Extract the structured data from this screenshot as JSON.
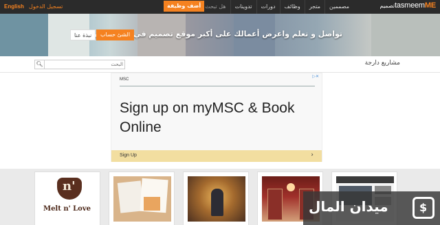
{
  "colors": {
    "accent": "#f58220",
    "topbar": "#2b2b2b",
    "ad_cta": "#f2dea0"
  },
  "topbar": {
    "logo_prefix": "tasmeem",
    "logo_bold": "ME",
    "logo_arabic": "تصميم",
    "nav": [
      "مصممين",
      "متجر",
      "وظائف",
      "دورات",
      "تدوينات",
      "هل تبحث عن موظف؟"
    ],
    "post_job": "أضف وظيفة",
    "login": "تسجيل الدخول",
    "language": "English"
  },
  "hero": {
    "headline": "تواصل و تعلم واعرض أعمالك على أكبر موقع تصميم في العالم العربي",
    "signup_button": "الشئ حساب",
    "about_button": "نبذة عنا"
  },
  "toolbar": {
    "section_title": "مشاريع دارجة",
    "search_placeholder": "البحث",
    "search_icon": "search-icon"
  },
  "ad": {
    "brand": "MSC",
    "headline": "Sign up on myMSC & Book Online",
    "cta": "Sign Up",
    "cta_icon": "chevron-right-icon",
    "info_icon": "ad-info-icon"
  },
  "cards": [
    {
      "thumb_text_top": "n'",
      "thumb_text_bottom": "Melt n' Love"
    },
    {},
    {},
    {},
    {}
  ],
  "watermark": {
    "text": "ميدان المال",
    "logo_glyph": "$"
  }
}
